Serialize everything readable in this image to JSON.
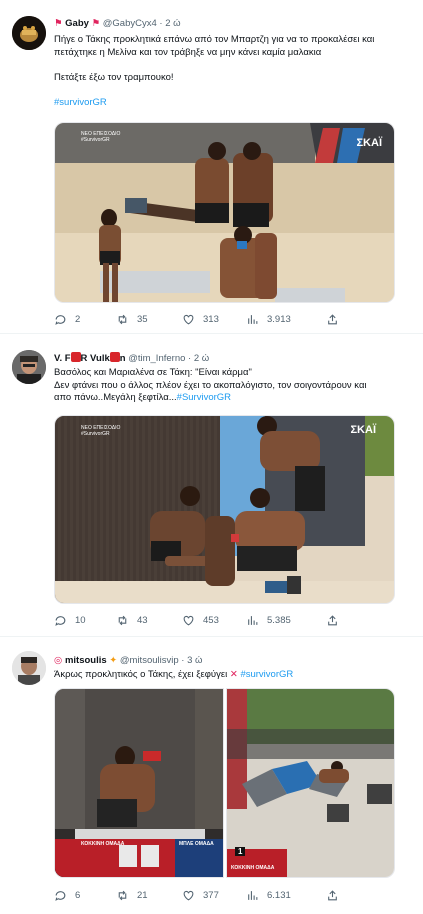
{
  "tweets": [
    {
      "name": "Gaby",
      "handle": "@GabyCyx4",
      "time": "2 ώ",
      "lines": [
        "Πήγε ο Τάκης προκλητικά επάνω από τον Μπαρτζη για να το προκαλέσει και",
        "πετάχτηκε η Μελίνα και τον τράβηξε να μην κάνει καμία μαλακια",
        "",
        "Πετάξτε έξω τον τραμπουκο!"
      ],
      "hashtag": "#survivorGR",
      "media_overlay": {
        "top_left": "ΝΕΟ ΕΠΕΙΣΟΔΙΟ #SurvivorGR",
        "top_right": "ΣΚΑΪ"
      },
      "stats": {
        "replies": "2",
        "retweets": "35",
        "likes": "313",
        "views": "3.913"
      }
    },
    {
      "name": "V. F Vulk n",
      "handle": "@tim_Inferno",
      "time": "2 ώ",
      "lines": [
        "Βασόλος και Μαριαλένα σε Τάκη: \"Είναι κάρμα\"",
        "Δεν φτάνει που ο άλλος πλέον έχει το ακοπαλόγιστο, τον σοιγοντάρουν και"
      ],
      "last_line": "απο πάνω..Μεγάλη ξεφτίλα...",
      "hashtag": "#SurvivorGR",
      "media_overlay": {
        "top_left": "ΝΕΟ ΕΠΕΙΣΟΔΙΟ #SurvivorGR",
        "top_right": "ΣΚΑΪ"
      },
      "stats": {
        "replies": "10",
        "retweets": "43",
        "likes": "453",
        "views": "5.385"
      }
    },
    {
      "name": "mitsoulis",
      "handle": "@mitsoulisvip",
      "time": "3 ώ",
      "line": "Άκρως προκλητικός ο Τάκης, έχει ξεφύγει",
      "hashtag": "#survivorGR",
      "media_overlay": {
        "left_team": "ΚΟΚΚΙΝΗ ΟΜΑΔΑ",
        "right_team": "ΜΠΛΕ ΟΜΑΔΑ",
        "right_badge": "1",
        "right_team_label": "ΚΟΚΚΙΝΗ ΟΜΑΔΑ"
      },
      "stats": {
        "replies": "6",
        "retweets": "21",
        "likes": "377",
        "views": "6.131"
      }
    }
  ],
  "colors": {
    "accent": "#1d9bf0",
    "text": "#0f1419",
    "muted": "#536471"
  },
  "icons": [
    "reply-icon",
    "retweet-icon",
    "like-icon",
    "views-icon",
    "share-icon"
  ]
}
